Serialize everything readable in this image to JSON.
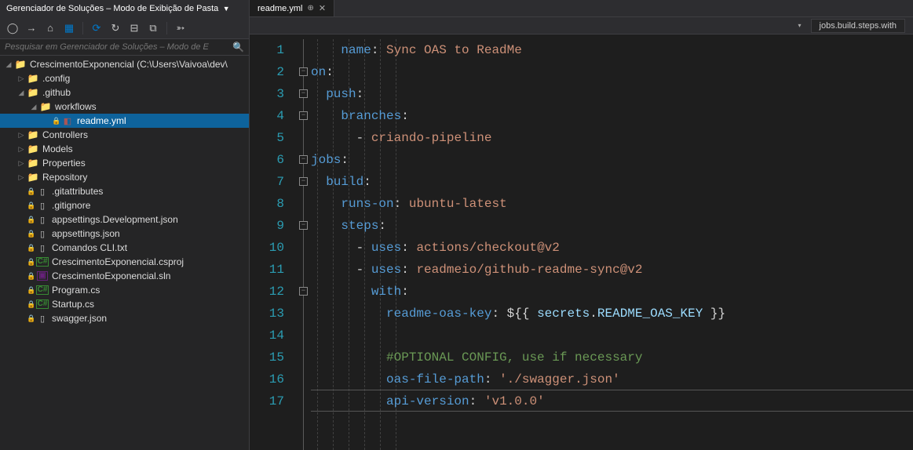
{
  "sidebar": {
    "title": "Gerenciador de Soluções – Modo de Exibição de Pasta",
    "searchPlaceholder": "Pesquisar em Gerenciador de Soluções – Modo de E",
    "tree": {
      "root": {
        "label": "CrescimentoExponencial (C:\\Users\\Vaivoa\\dev\\"
      },
      "config": {
        "label": ".config"
      },
      "github": {
        "label": ".github"
      },
      "workflows": {
        "label": "workflows"
      },
      "readme": {
        "label": "readme.yml"
      },
      "controllers": {
        "label": "Controllers"
      },
      "models": {
        "label": "Models"
      },
      "properties": {
        "label": "Properties"
      },
      "repository": {
        "label": "Repository"
      },
      "gitattributes": {
        "label": ".gitattributes"
      },
      "gitignore": {
        "label": ".gitignore"
      },
      "appsettingsDev": {
        "label": "appsettings.Development.json"
      },
      "appsettings": {
        "label": "appsettings.json"
      },
      "comandos": {
        "label": "Comandos CLI.txt"
      },
      "csproj": {
        "label": "CrescimentoExponencial.csproj"
      },
      "sln": {
        "label": "CrescimentoExponencial.sln"
      },
      "program": {
        "label": "Program.cs"
      },
      "startup": {
        "label": "Startup.cs"
      },
      "swagger": {
        "label": "swagger.json"
      }
    }
  },
  "editor": {
    "tab": {
      "label": "readme.yml"
    },
    "breadcrumb": "jobs.build.steps.with",
    "lineNumbers": [
      "1",
      "2",
      "3",
      "4",
      "5",
      "6",
      "7",
      "8",
      "9",
      "10",
      "11",
      "12",
      "13",
      "14",
      "15",
      "16",
      "17"
    ]
  },
  "code": {
    "l1": {
      "k1": "name",
      "c": ":",
      "v": "Sync OAS to ReadMe"
    },
    "l2": {
      "k1": "on",
      "c": ":"
    },
    "l3": {
      "k1": "push",
      "c": ":"
    },
    "l4": {
      "k1": "branches",
      "c": ":"
    },
    "l5": {
      "d": "-",
      "v": "criando-pipeline"
    },
    "l6": {
      "k1": "jobs",
      "c": ":"
    },
    "l7": {
      "k1": "build",
      "c": ":"
    },
    "l8": {
      "k1": "runs-on",
      "c": ":",
      "v": "ubuntu-latest"
    },
    "l9": {
      "k1": "steps",
      "c": ":"
    },
    "l10": {
      "d": "-",
      "k1": "uses",
      "c": ":",
      "v": "actions/checkout@v2"
    },
    "l11": {
      "d": "-",
      "k1": "uses",
      "c": ":",
      "v": "readmeio/github-readme-sync@v2"
    },
    "l12": {
      "k1": "with",
      "c": ":"
    },
    "l13": {
      "k1": "readme-oas-key",
      "c": ":",
      "v1": "${{ ",
      "v2": "secrets",
      "v3": ".",
      "v4": "README_OAS_KEY",
      "v5": " }}"
    },
    "l15": {
      "comment": "#OPTIONAL CONFIG, use if necessary"
    },
    "l16": {
      "k1": "oas-file-path",
      "c": ":",
      "v": "'./swagger.json'"
    },
    "l17": {
      "k1": "api-version",
      "c": ":",
      "v": "'v1.0.0'"
    }
  }
}
